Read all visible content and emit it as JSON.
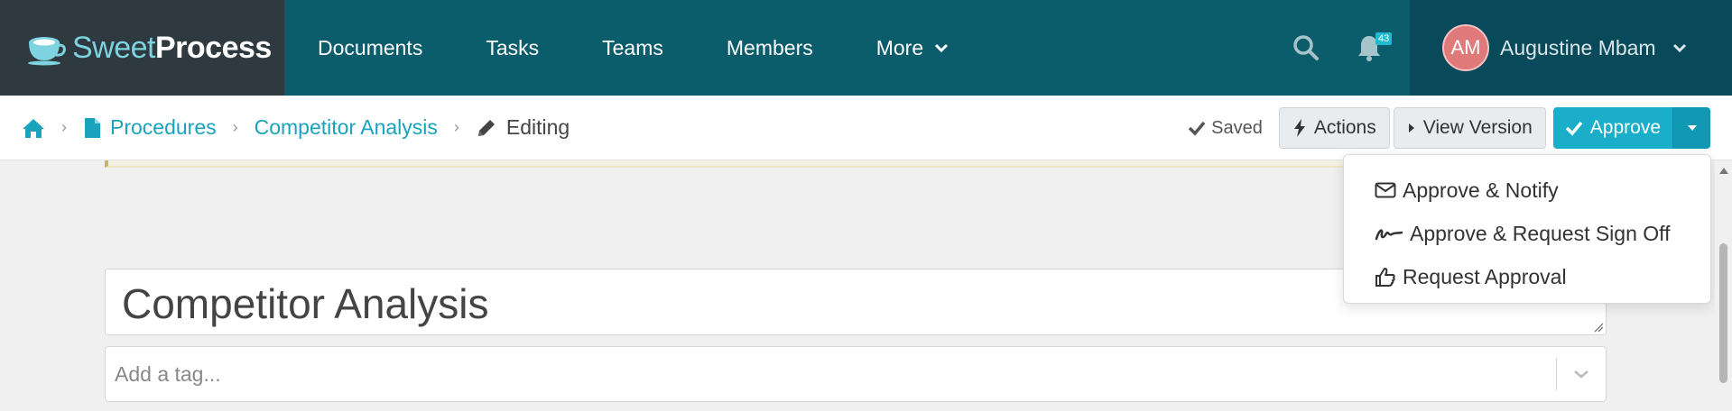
{
  "brand": {
    "sweet": "Sweet",
    "process": "Process"
  },
  "nav": {
    "items": [
      "Documents",
      "Tasks",
      "Teams",
      "Members"
    ],
    "more_label": "More",
    "notification_count": "43"
  },
  "user": {
    "initials": "AM",
    "name": "Augustine Mbam"
  },
  "breadcrumb": {
    "procedures": "Procedures",
    "document": "Competitor Analysis",
    "current": "Editing"
  },
  "toolbar": {
    "saved_label": "Saved",
    "actions_label": "Actions",
    "view_version_label": "View Version",
    "approve_label": "Approve"
  },
  "approve_menu": {
    "items": [
      "Approve & Notify",
      "Approve & Request Sign Off",
      "Request Approval"
    ]
  },
  "editor": {
    "title": "Competitor Analysis",
    "tag_placeholder": "Add a tag..."
  },
  "colors": {
    "nav_bg": "#0b5d6b",
    "logo_bg": "#2e3a40",
    "accent": "#1aaecb",
    "link": "#1aa3bd"
  }
}
